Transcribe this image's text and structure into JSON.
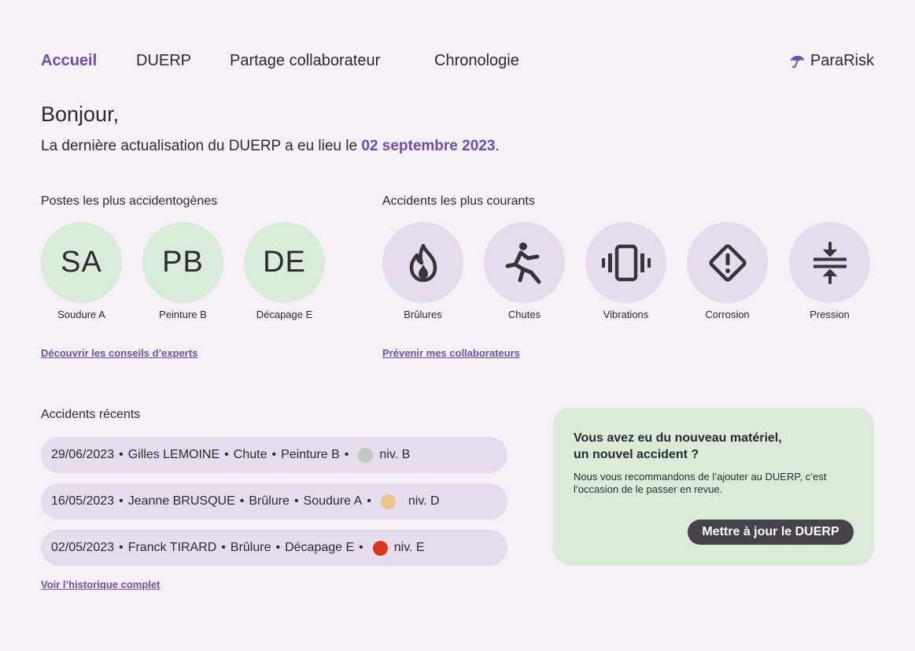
{
  "nav": {
    "items": [
      {
        "label": "Accueil",
        "active": true
      },
      {
        "label": "DUERP",
        "active": false
      },
      {
        "label": "Partage collaborateur",
        "active": false
      },
      {
        "label": "Chronologie",
        "active": false
      }
    ],
    "brand": "ParaRisk",
    "brand_icon": "umbrella-icon"
  },
  "greeting": "Bonjour,",
  "update": {
    "prefix": "La dernière actualisation du DUERP a eu lieu le ",
    "date": "02 septembre 2023",
    "suffix": "."
  },
  "posts": {
    "title": "Postes les plus accidentogènes",
    "items": [
      {
        "initials": "SA",
        "label": "Soudure A"
      },
      {
        "initials": "PB",
        "label": "Peinture B"
      },
      {
        "initials": "DE",
        "label": "Décapage E"
      }
    ],
    "link": "Découvrir les conseils d’experts"
  },
  "accidents": {
    "title": "Accidents les plus courants",
    "items": [
      {
        "icon": "flame-icon",
        "label": "Brûlures"
      },
      {
        "icon": "falling-person-icon",
        "label": "Chutes"
      },
      {
        "icon": "vibration-icon",
        "label": "Vibrations"
      },
      {
        "icon": "warning-diamond-icon",
        "label": "Corrosion"
      },
      {
        "icon": "compress-icon",
        "label": "Pression"
      }
    ],
    "link": "Prévenir mes collaborateurs"
  },
  "recent": {
    "title": "Accidents récents",
    "rows": [
      {
        "date": "29/06/2023",
        "person": "Gilles LEMOINE",
        "type": "Chute",
        "post": "Peinture B",
        "level": "niv. B",
        "color": "#c3c7c5"
      },
      {
        "date": "16/05/2023",
        "person": "Jeanne BRUSQUE",
        "type": "Brûlure",
        "post": "Soudure A",
        "level": "niv. D",
        "color": "#e8c48f"
      },
      {
        "date": "02/05/2023",
        "person": "Franck TIRARD",
        "type": "Brûlure",
        "post": "Décapage E",
        "level": "niv. E",
        "color": "#d9361b"
      }
    ],
    "separator": "•",
    "link": "Voir l’historique complet"
  },
  "card": {
    "title_line1": "Vous avez eu du nouveau matériel,",
    "title_line2": "un nouvel accident ?",
    "text": "Nous vous recommandons de l’ajouter au DUERP, c’est l’occasion de le passer en revue.",
    "button": "Mettre à jour le DUERP"
  },
  "colors": {
    "accent": "#6a4fb0",
    "background": "#f5f1f6",
    "green": "#d9ecd8",
    "lavender": "#e7dcec",
    "button": "#45424a"
  }
}
